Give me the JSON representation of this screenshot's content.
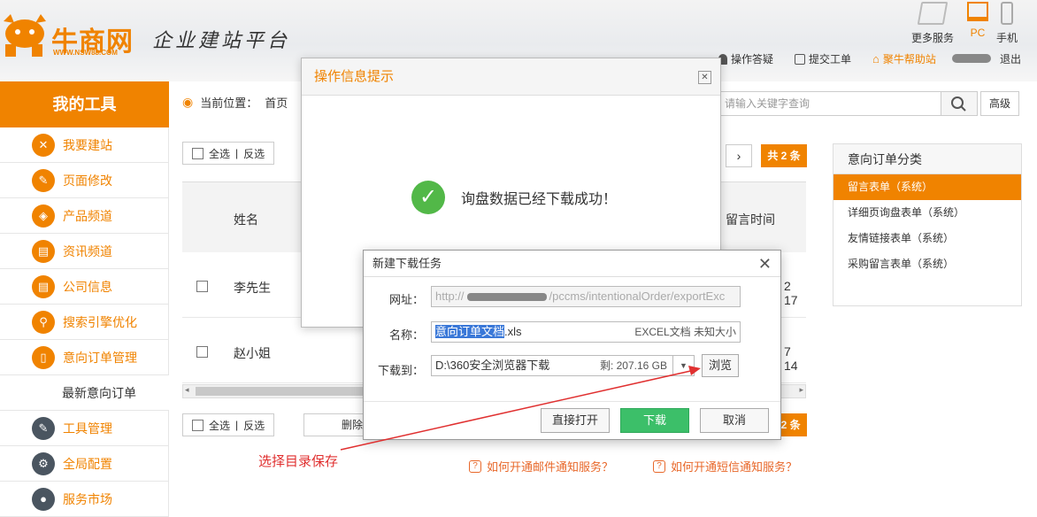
{
  "brand": {
    "name": "牛商网",
    "url": "WWW.NSW88.COM",
    "slogan": "企业建站平台"
  },
  "top_icons": [
    {
      "icon": "more-services-icon",
      "label": "更多服务"
    },
    {
      "icon": "pc-icon",
      "label": "PC"
    },
    {
      "icon": "phone-icon",
      "label": "手机"
    }
  ],
  "top_links": {
    "faq": "操作答疑",
    "ticket": "提交工单",
    "help": "聚牛帮助站",
    "logout": "退出"
  },
  "sidebar": {
    "title": "我的工具",
    "items": [
      {
        "label": "我要建站",
        "icon": "tools-icon"
      },
      {
        "label": "页面修改",
        "icon": "pen-icon"
      },
      {
        "label": "产品频道",
        "icon": "box-icon"
      },
      {
        "label": "资讯频道",
        "icon": "news-icon"
      },
      {
        "label": "公司信息",
        "icon": "company-icon"
      },
      {
        "label": "搜索引擎优化",
        "icon": "search-icon"
      },
      {
        "label": "意向订单管理",
        "icon": "order-icon"
      }
    ],
    "sub_item": "最新意向订单",
    "items2": [
      {
        "label": "工具管理",
        "icon": "wrench-icon"
      },
      {
        "label": "全局配置",
        "icon": "gear-icon"
      },
      {
        "label": "服务市场",
        "icon": "market-icon"
      }
    ]
  },
  "breadcrumb": {
    "prefix": "当前位置：",
    "home": "首页"
  },
  "search": {
    "placeholder": "请输入关键字查询",
    "advanced": "高级"
  },
  "selection": {
    "all": "全选",
    "sep": "|",
    "invert": "反选",
    "delete": "删除"
  },
  "pager": {
    "total": "共 2 条"
  },
  "table": {
    "headers": {
      "name": "姓名",
      "time": "留言时间"
    },
    "rows": [
      {
        "name": "李先生",
        "time": "2 17"
      },
      {
        "name": "赵小姐",
        "time": "7 14"
      }
    ]
  },
  "right_panel": {
    "title": "意向订单分类",
    "items": [
      "留言表单（系统）",
      "详细页询盘表单（系统）",
      "友情链接表单（系统）",
      "采购留言表单（系统）"
    ]
  },
  "notify": {
    "email": "如何开通邮件通知服务？",
    "sms": "如何开通短信通知服务？"
  },
  "info_dialog": {
    "title": "操作信息提示",
    "message": "询盘数据已经下载成功！"
  },
  "download_dialog": {
    "title": "新建下载任务",
    "url_label": "网址：",
    "url_prefix": "http://",
    "url_suffix": "/pccms/intentionalOrder/exportExc",
    "name_label": "名称：",
    "name_selected": "意向订单文档",
    "name_ext": ".xls",
    "file_info": "EXCEL文档 未知大小",
    "dir_label": "下载到：",
    "dir_path": "D:\\360安全浏览器下载",
    "dir_space": "剩: 207.16 GB",
    "browse": "浏览",
    "open_direct": "直接打开",
    "download": "下载",
    "cancel": "取消"
  },
  "annotation": "选择目录保存",
  "colors": {
    "brand_orange": "#f08300",
    "success_green": "#52b848",
    "download_green": "#3cbf69",
    "annotation_red": "#e03030"
  }
}
